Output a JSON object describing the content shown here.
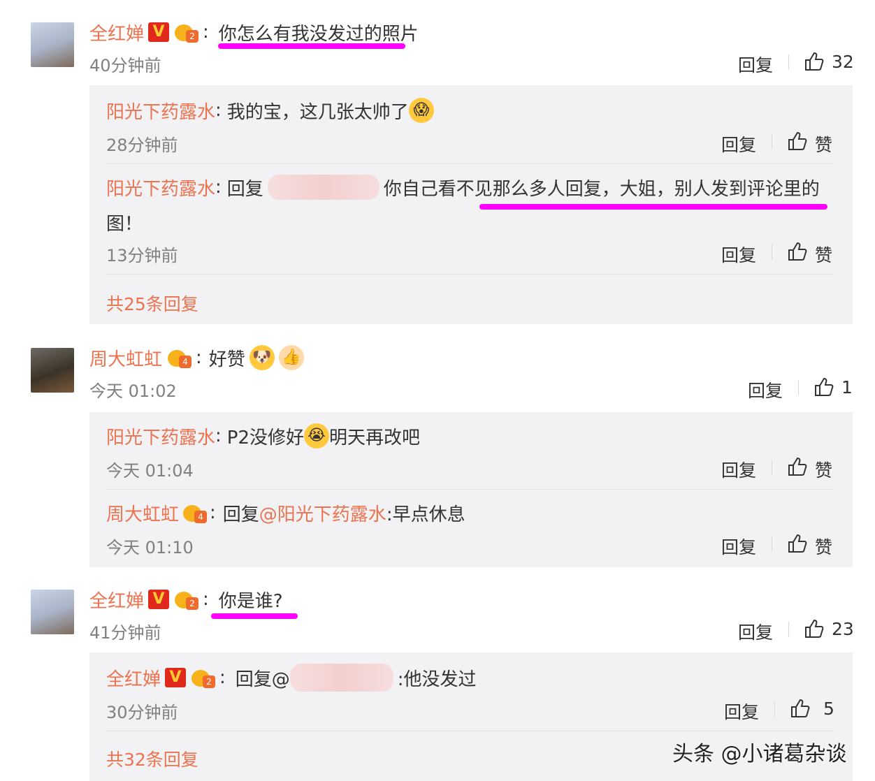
{
  "comments": [
    {
      "author": "全红婵",
      "verified": "V",
      "level": "2",
      "colon": ":",
      "text": "你怎么有我没发过的照片",
      "time": "40分钟前",
      "reply_label": "回复",
      "like_count": "32",
      "replies": [
        {
          "author": "阳光下药露水",
          "text": "我的宝，这几张太帅了",
          "time": "28分钟前",
          "reply_label": "回复",
          "like_label": "赞"
        },
        {
          "author": "阳光下药露水",
          "prefix": "回复",
          "text_line1": "你自己看不见那么多人回复，大姐，别人发到评论里的",
          "text_line2": "图！",
          "time": "13分钟前",
          "reply_label": "回复",
          "like_label": "赞"
        }
      ],
      "more_replies": "共25条回复"
    },
    {
      "author": "周大虹虹",
      "level": "4",
      "text": "好赞",
      "time": "今天 01:02",
      "reply_label": "回复",
      "like_count": "1",
      "replies": [
        {
          "author": "阳光下药露水",
          "text_a": "P2没修好",
          "text_b": "明天再改吧",
          "time": "今天 01:04",
          "reply_label": "回复",
          "like_label": "赞"
        },
        {
          "author": "周大虹虹",
          "prefix": "回复",
          "mention": "@阳光下药露水",
          "text": ":早点休息",
          "time": "今天 01:10",
          "reply_label": "回复",
          "like_label": "赞"
        }
      ]
    },
    {
      "author": "全红婵",
      "verified": "V",
      "level": "2",
      "text": "你是谁?",
      "time": "41分钟前",
      "reply_label": "回复",
      "like_count": "23",
      "replies": [
        {
          "author": "全红婵",
          "prefix": "回复@",
          "text": ":他没发过",
          "time": "30分钟前",
          "reply_label": "回复",
          "like_count": "5"
        }
      ],
      "more_replies": "共32条回复"
    }
  ],
  "watermark": "头条 @小诸葛杂谈",
  "colors": {
    "name": "#eb7350",
    "highlight": "#ff00ff",
    "reply_bg": "#f2f2f5"
  }
}
